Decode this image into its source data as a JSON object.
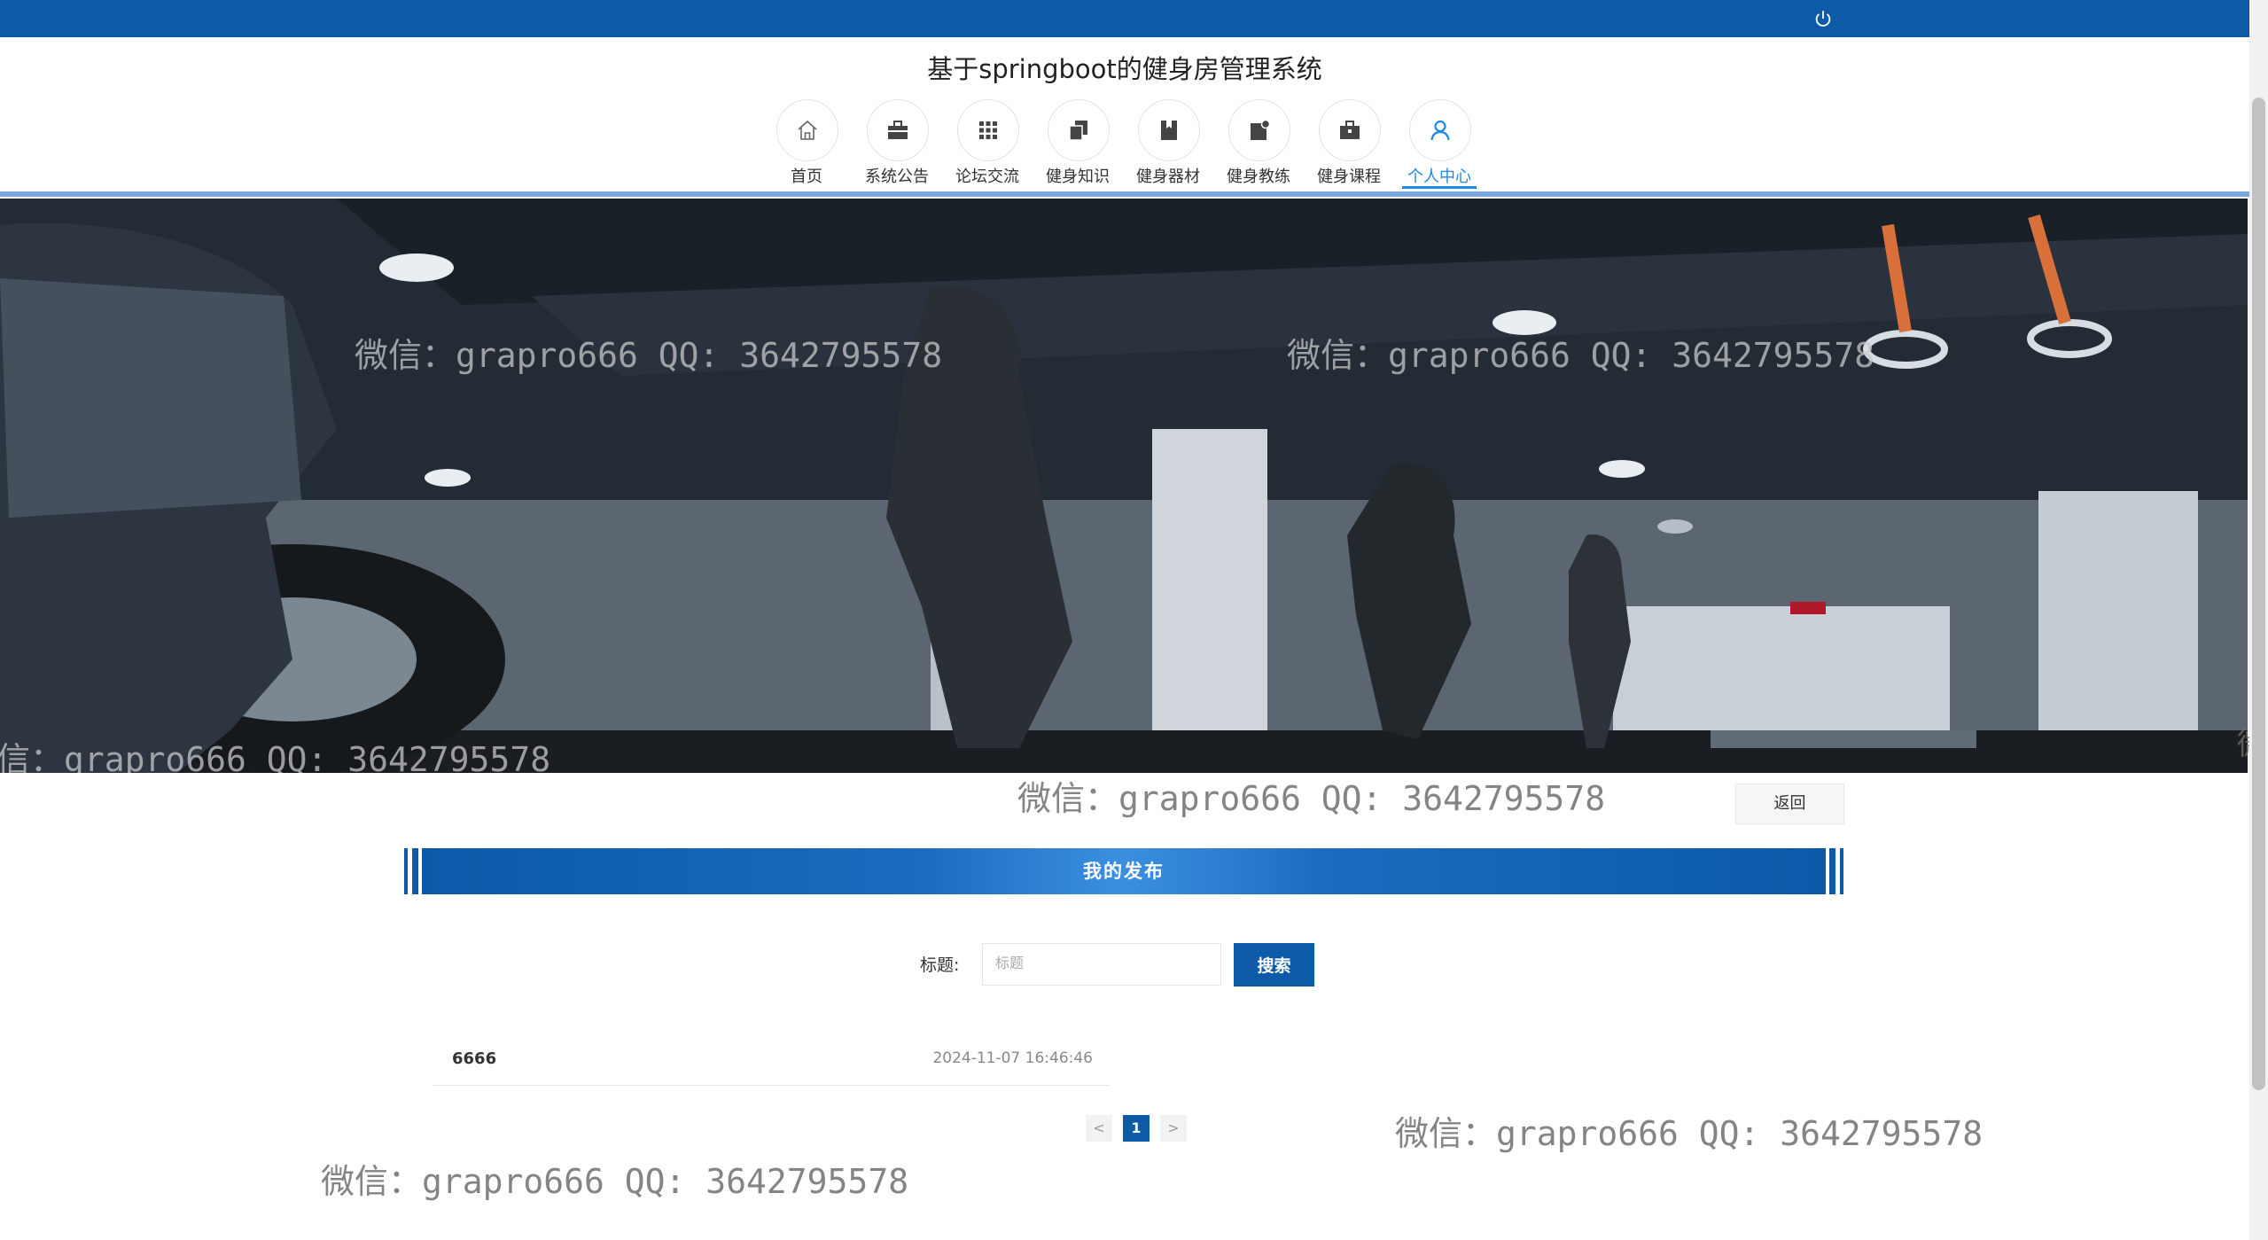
{
  "header": {
    "site_title": "基于springboot的健身房管理系统",
    "logout_icon": "power-icon"
  },
  "nav": {
    "items": [
      {
        "label": "首页",
        "icon": "home-icon"
      },
      {
        "label": "系统公告",
        "icon": "briefcase-icon"
      },
      {
        "label": "论坛交流",
        "icon": "grid-icon"
      },
      {
        "label": "健身知识",
        "icon": "copy-icon"
      },
      {
        "label": "健身器材",
        "icon": "bookmark-icon"
      },
      {
        "label": "健身教练",
        "icon": "note-icon"
      },
      {
        "label": "健身课程",
        "icon": "suitcase-icon"
      },
      {
        "label": "个人中心",
        "icon": "user-icon"
      }
    ],
    "active_index": 7
  },
  "banner": {
    "watermark": "微信：grapro666 QQ: 3642795578",
    "watermark_partial": "信：grapro666 QQ: 3642795578",
    "edge_char": "微"
  },
  "page": {
    "back_label": "返回",
    "section_title": "我的发布",
    "search_label": "标题:",
    "search_placeholder": "标题",
    "search_button": "搜索"
  },
  "posts": [
    {
      "title": "6666",
      "time": "2024-11-07 16:46:46"
    }
  ],
  "pagination": {
    "prev": "<",
    "current": "1",
    "next": ">"
  },
  "watermarks": {
    "text": "微信：grapro666 QQ: 3642795578"
  },
  "colors": {
    "primary": "#0d5aa7",
    "active_nav": "#1e88e5",
    "nav_divider": "#7aa9dd"
  }
}
